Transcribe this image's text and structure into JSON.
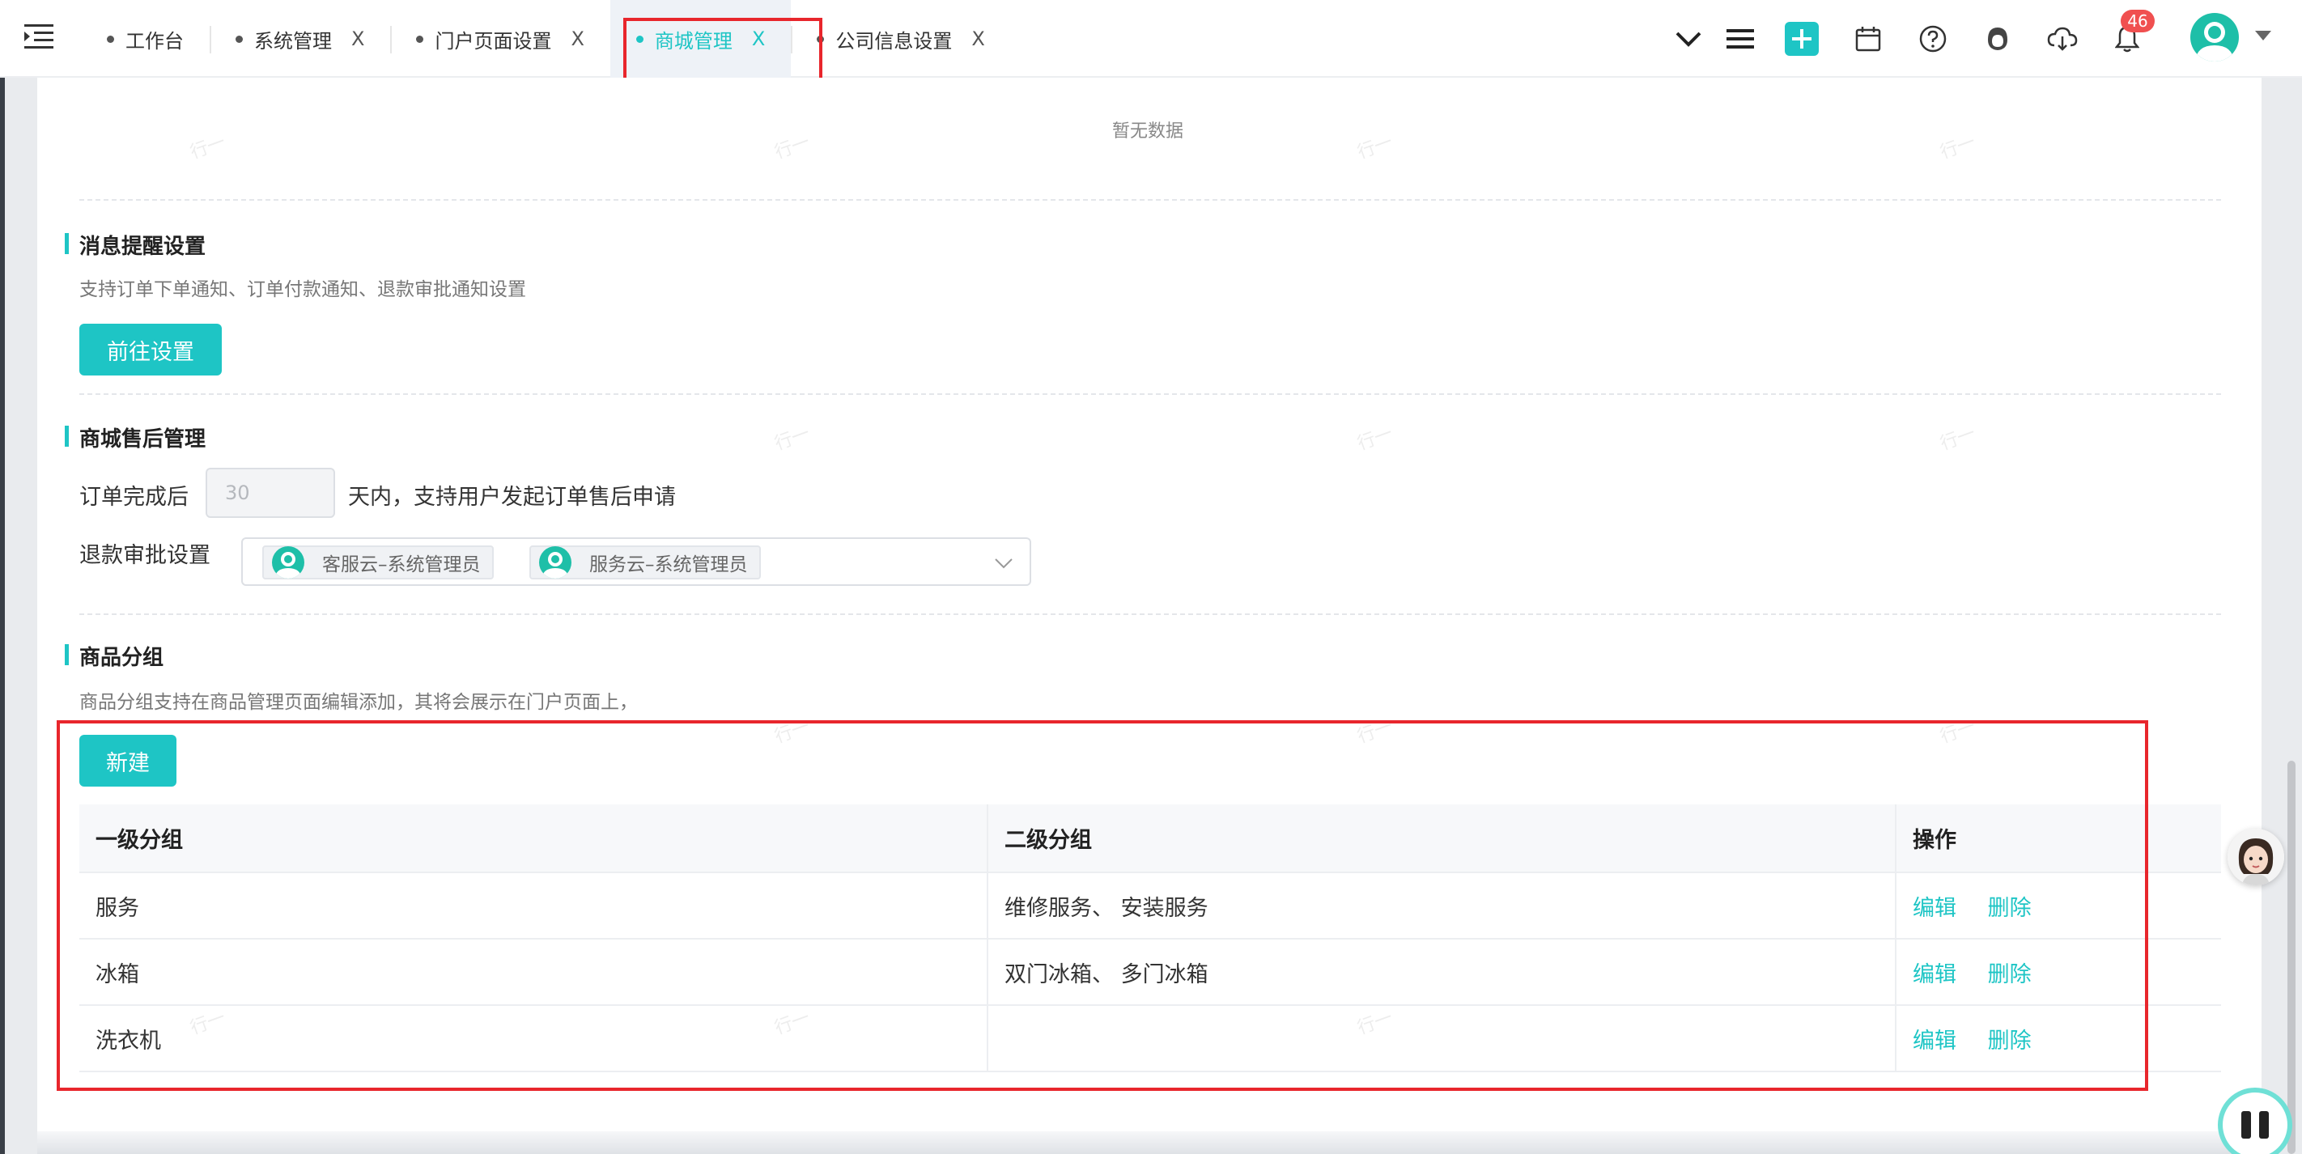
{
  "tabs": [
    {
      "label": "工作台",
      "closable": false,
      "active": false
    },
    {
      "label": "系统管理",
      "closable": true,
      "active": false
    },
    {
      "label": "门户页面设置",
      "closable": true,
      "active": false
    },
    {
      "label": "商城管理",
      "closable": true,
      "active": true
    },
    {
      "label": "公司信息设置",
      "closable": true,
      "active": false
    }
  ],
  "tab_close_glyph": "X",
  "header": {
    "notification_count": "46",
    "icons": [
      "chevron-down-icon",
      "list-icon",
      "add-icon",
      "calendar-icon",
      "help-icon",
      "service-icon",
      "cloud-download-icon",
      "bell-icon"
    ]
  },
  "empty_state": "暂无数据",
  "watermark": "行一",
  "message_settings": {
    "title": "消息提醒设置",
    "desc": "支持订单下单通知、订单付款通知、退款审批通知设置",
    "button": "前往设置"
  },
  "after_sales": {
    "title": "商城售后管理",
    "prefix": "订单完成后",
    "days_placeholder": "30",
    "suffix": "天内，支持用户发起订单售后申请",
    "refund_label": "退款审批设置",
    "approvers": [
      "客服云–系统管理员",
      "服务云–系统管理员"
    ]
  },
  "product_groups": {
    "title": "商品分组",
    "desc": "商品分组支持在商品管理页面编辑添加，其将会展示在门户页面上，",
    "new_button": "新建",
    "columns": [
      "一级分组",
      "二级分组",
      "操作"
    ],
    "rows": [
      {
        "primary": "服务",
        "secondary": "维修服务、 安装服务"
      },
      {
        "primary": "冰箱",
        "secondary": "双门冰箱、 多门冰箱"
      },
      {
        "primary": "洗衣机",
        "secondary": ""
      }
    ],
    "edit_label": "编辑",
    "delete_label": "删除"
  },
  "colors": {
    "accent": "#1ec5c5",
    "highlight": "#e8262c",
    "badge": "#f05050"
  }
}
